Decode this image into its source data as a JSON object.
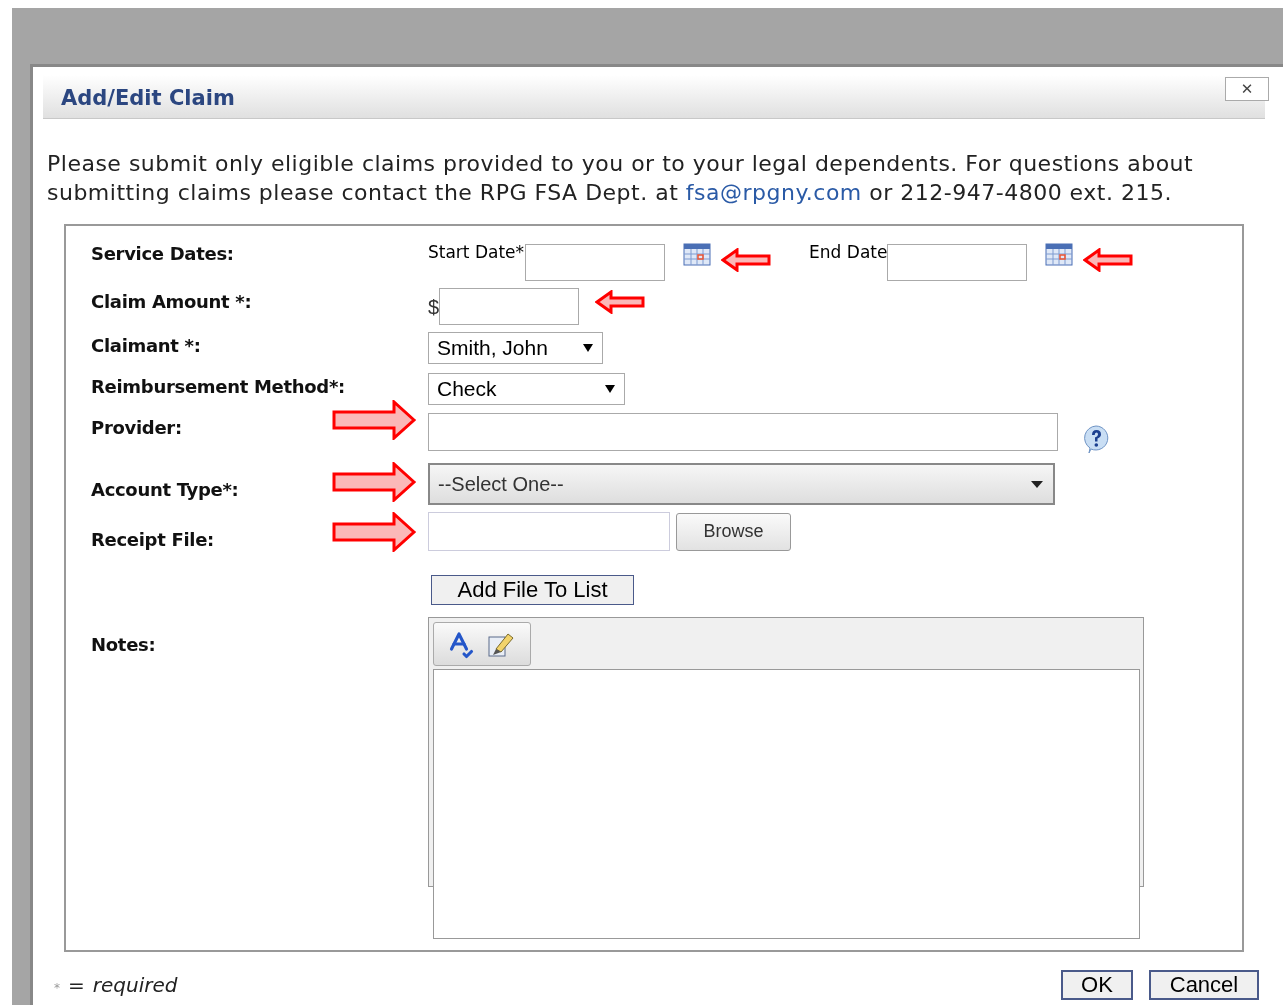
{
  "dialog": {
    "title": "Add/Edit Claim",
    "close_label": "✕"
  },
  "intro": {
    "before": "Please submit only eligible claims provided to you or to your legal dependents. For questions about submitting claims please contact the RPG FSA Dept. at",
    "link": "fsa@rpgny.com",
    "after": "or 212-947-4800 ext. 215."
  },
  "fields": [
    {
      "kind": "dates",
      "label": "Service Dates:",
      "start_label": "Start Date*",
      "end_label": "End Date",
      "start_annotated": true,
      "end_annotated": true
    },
    {
      "kind": "amount",
      "label": "Claim Amount *:",
      "prefix": "$",
      "annotated": true
    },
    {
      "kind": "select",
      "label": "Claimant *:",
      "value": "Smith, John"
    },
    {
      "kind": "select",
      "label": "Reimbursement Method*:",
      "value": "Check"
    },
    {
      "kind": "text",
      "label": "Provider:",
      "annotated": true
    },
    {
      "kind": "wide_select",
      "label": "Account Type*:",
      "value": "--Select One--",
      "annotated": true
    },
    {
      "kind": "file",
      "label": "Receipt File:",
      "button": "Browse",
      "add_button": "Add File To List",
      "annotated": true
    },
    {
      "kind": "notes",
      "label": "Notes:"
    }
  ],
  "legend": {
    "mark": "*",
    "equals": "=",
    "word": "required"
  },
  "buttons": [
    "OK",
    "Cancel"
  ]
}
